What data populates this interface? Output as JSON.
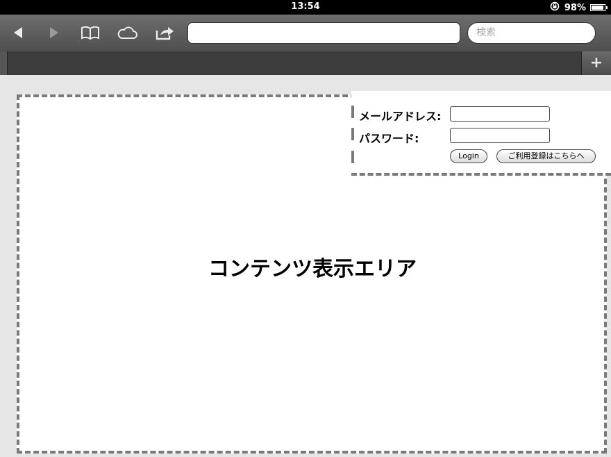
{
  "status_bar": {
    "time": "13:54",
    "battery": "98%",
    "battery_level": 0.98
  },
  "toolbar": {
    "icons": [
      "back-arrow-icon",
      "forward-arrow-icon",
      "bookmarks-icon",
      "icloud-tabs-icon",
      "share-icon"
    ],
    "url_value": "",
    "search_placeholder": "検索"
  },
  "tabbar": {
    "add_tab_label": "+"
  },
  "login": {
    "email_label": "メールアドレス:",
    "password_label": "パスワード:",
    "email_value": "",
    "password_value": "",
    "login_button": "Login",
    "register_button": "ご利用登録はこちらへ"
  },
  "content": {
    "label": "コンテンツ表示エリア"
  }
}
